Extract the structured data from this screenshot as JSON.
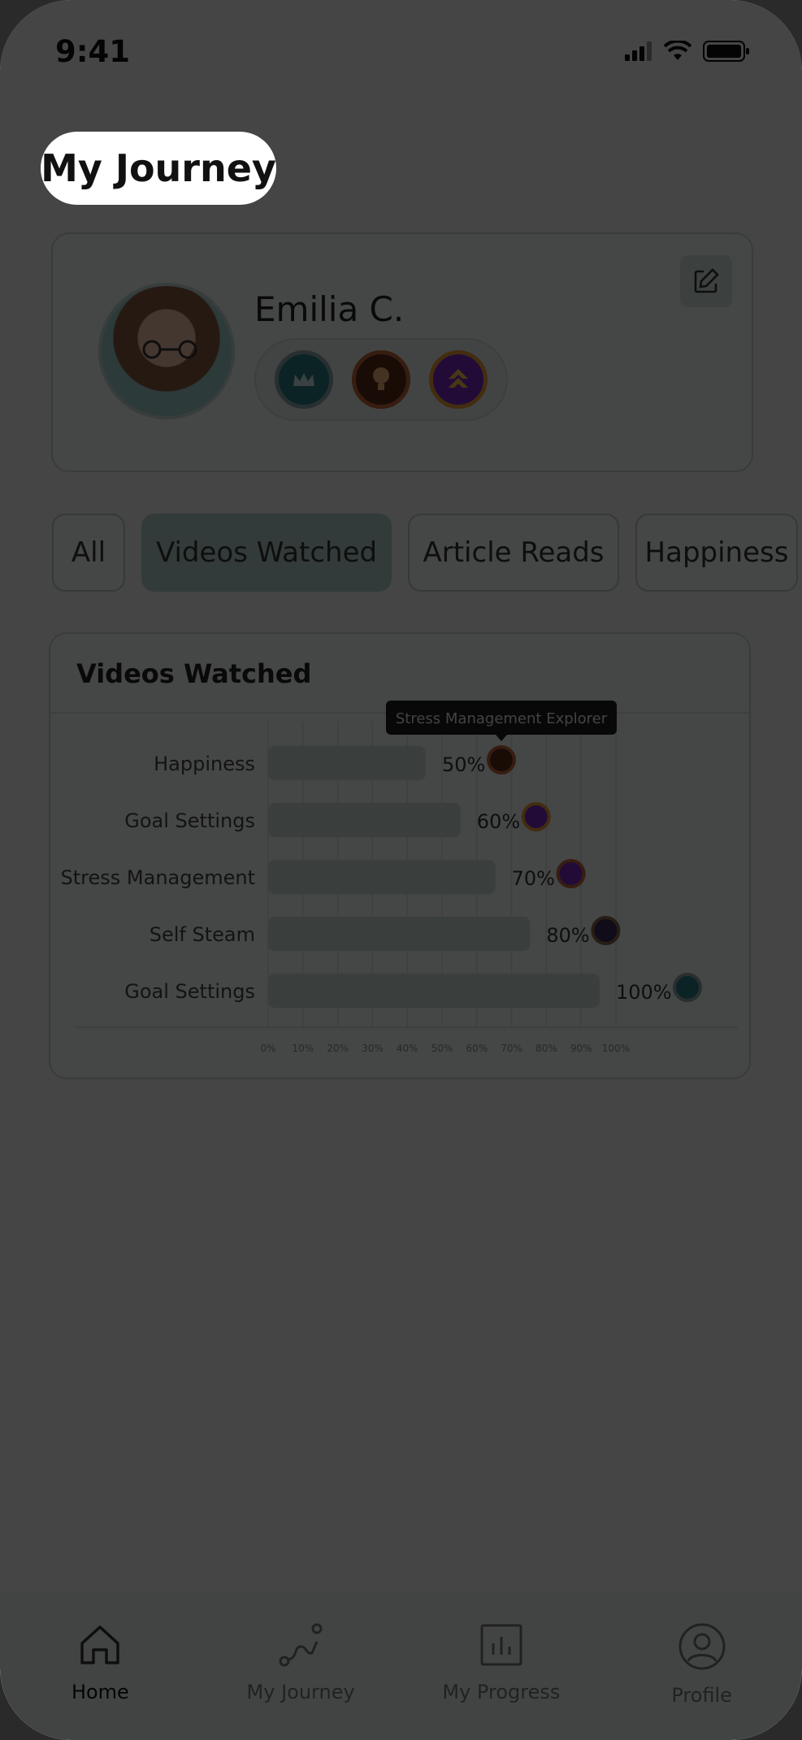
{
  "status_bar": {
    "time": "9:41"
  },
  "page_title": "My Journey",
  "profile": {
    "name": "Emilia C."
  },
  "tabs": [
    "All",
    "Videos Watched",
    "Article Reads",
    "Happiness"
  ],
  "chart_card": {
    "title": "Videos Watched",
    "tooltip": "Stress Management Explorer"
  },
  "chart_data": {
    "type": "bar",
    "orientation": "horizontal",
    "categories": [
      "Happiness",
      "Goal Settings",
      "Stress Management",
      "Self Steam",
      "Goal Settings"
    ],
    "values": [
      50,
      60,
      70,
      80,
      100
    ],
    "value_labels": [
      "50%",
      "60%",
      "70%",
      "80%",
      "100%"
    ],
    "x_ticks": [
      "0%",
      "10%",
      "20%",
      "30%",
      "40%",
      "50%",
      "60%",
      "70%",
      "80%",
      "90%",
      "100%"
    ],
    "xlim": [
      0,
      100
    ],
    "grid": true,
    "bar_color": "#cfe3dd"
  },
  "nav": [
    {
      "label": "Home",
      "icon": "home-icon",
      "active": true
    },
    {
      "label": "My Journey",
      "icon": "journey-icon",
      "active": false
    },
    {
      "label": "My Progress",
      "icon": "progress-chart-icon",
      "active": false
    },
    {
      "label": "Profile",
      "icon": "user-icon",
      "active": false
    }
  ]
}
